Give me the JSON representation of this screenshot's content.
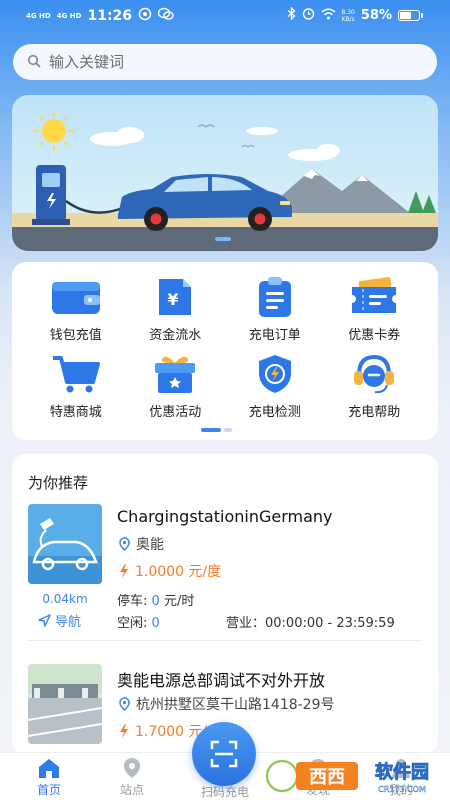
{
  "status_bar": {
    "sim1": "4G HD",
    "sim2": "4G HD",
    "time": "11:26",
    "speed_value": "8.30",
    "speed_unit": "KB/s",
    "battery": "58%"
  },
  "search": {
    "placeholder": "输入关键词"
  },
  "menu": {
    "items": [
      {
        "label": "钱包充值",
        "icon": "wallet-icon"
      },
      {
        "label": "资金流水",
        "icon": "yuan-bill-icon"
      },
      {
        "label": "充电订单",
        "icon": "clipboard-icon"
      },
      {
        "label": "优惠卡券",
        "icon": "ticket-icon"
      },
      {
        "label": "特惠商城",
        "icon": "shopping-cart-icon"
      },
      {
        "label": "优惠活动",
        "icon": "gift-icon"
      },
      {
        "label": "充电检测",
        "icon": "shield-bolt-icon"
      },
      {
        "label": "充电帮助",
        "icon": "headset-icon"
      }
    ]
  },
  "recommend": {
    "title": "为你推荐",
    "stations": [
      {
        "name": "ChargingstationinGermany",
        "location": "奥能",
        "price": "1.0000 元/度",
        "distance": "0.04km",
        "nav_label": "导航",
        "parking_label": "停车:",
        "parking_value": "0",
        "parking_unit": "元/时",
        "idle_label": "空闲:",
        "idle_value": "0",
        "hours": "营业：00:00:00 - 23:59:59"
      },
      {
        "name": "奥能电源总部调试不对外开放",
        "location": "杭州拱墅区莫干山路1418-29号",
        "price": "1.7000 元/度"
      }
    ]
  },
  "tabbar": {
    "home": "首页",
    "stations": "站点",
    "scan": "扫码充电",
    "discover": "发现",
    "mine": "我的"
  },
  "watermark": {
    "brand": "西西软件园",
    "url": "CR173.COM"
  },
  "colors": {
    "accent": "#3d86ee",
    "price": "#f07d2b",
    "header": "#3a8ff0"
  }
}
